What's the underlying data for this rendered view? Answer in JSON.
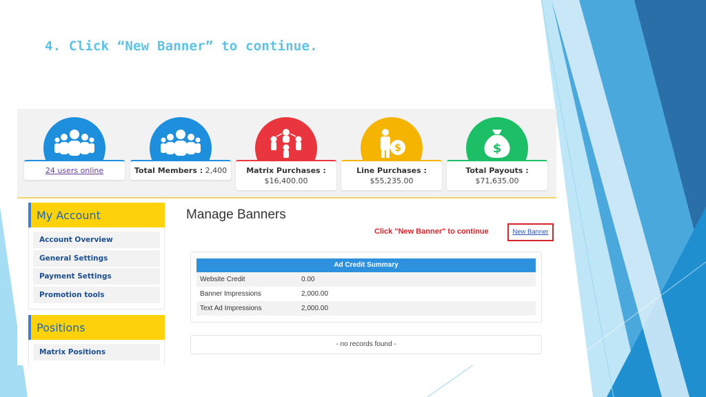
{
  "slide": {
    "title": "4. Click “New Banner” to continue."
  },
  "stats": [
    {
      "icon": "users-icon",
      "color": "#1e8fdc",
      "link_text": "24 users online"
    },
    {
      "icon": "members-icon",
      "color": "#1e8fdc",
      "label": "Total Members :",
      "value": "2,400"
    },
    {
      "icon": "matrix-icon",
      "color": "#e8353e",
      "label": "Matrix Purchases :",
      "value": "$16,400.00"
    },
    {
      "icon": "dollar-person-icon",
      "color": "#f5b400",
      "label": "Line Purchases :",
      "value": "$55,235.00"
    },
    {
      "icon": "money-bag-icon",
      "color": "#1dbf66",
      "label": "Total Payouts :",
      "value": "$71,635.00"
    }
  ],
  "sidebar": {
    "account_title": "My Account",
    "account_items": [
      "Account Overview",
      "General Settings",
      "Payment Settings",
      "Promotion tools"
    ],
    "positions_title": "Positions",
    "positions_items": [
      "Matrix Positions"
    ]
  },
  "main": {
    "title": "Manage Banners",
    "hint": "Click \"New Banner\" to continue",
    "new_banner": "New Banner",
    "summary": {
      "title": "Ad Credit Summary",
      "rows": [
        {
          "label": "Website Credit",
          "value": "0.00"
        },
        {
          "label": "Banner Impressions",
          "value": "2,000.00"
        },
        {
          "label": "Text Ad Impressions",
          "value": "2,000.00"
        }
      ]
    },
    "no_records": "- no records found -"
  },
  "colors": {
    "accent_blue": "#2e91de",
    "highlight_red": "#d8232a",
    "sidebar_yellow": "#fdd20a"
  }
}
